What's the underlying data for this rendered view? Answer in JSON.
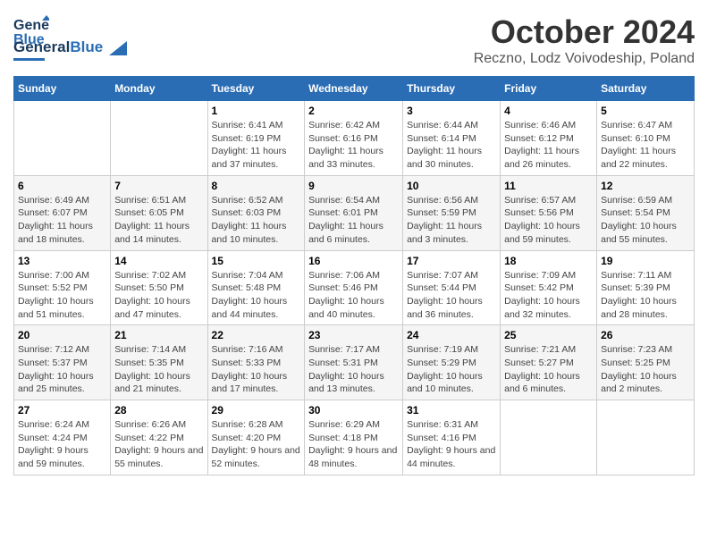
{
  "logo": {
    "general": "General",
    "blue": "Blue",
    "tagline": ""
  },
  "header": {
    "month": "October 2024",
    "location": "Reczno, Lodz Voivodeship, Poland"
  },
  "weekdays": [
    "Sunday",
    "Monday",
    "Tuesday",
    "Wednesday",
    "Thursday",
    "Friday",
    "Saturday"
  ],
  "weeks": [
    [
      {
        "day": "",
        "info": ""
      },
      {
        "day": "",
        "info": ""
      },
      {
        "day": "1",
        "info": "Sunrise: 6:41 AM\nSunset: 6:19 PM\nDaylight: 11 hours and 37 minutes."
      },
      {
        "day": "2",
        "info": "Sunrise: 6:42 AM\nSunset: 6:16 PM\nDaylight: 11 hours and 33 minutes."
      },
      {
        "day": "3",
        "info": "Sunrise: 6:44 AM\nSunset: 6:14 PM\nDaylight: 11 hours and 30 minutes."
      },
      {
        "day": "4",
        "info": "Sunrise: 6:46 AM\nSunset: 6:12 PM\nDaylight: 11 hours and 26 minutes."
      },
      {
        "day": "5",
        "info": "Sunrise: 6:47 AM\nSunset: 6:10 PM\nDaylight: 11 hours and 22 minutes."
      }
    ],
    [
      {
        "day": "6",
        "info": "Sunrise: 6:49 AM\nSunset: 6:07 PM\nDaylight: 11 hours and 18 minutes."
      },
      {
        "day": "7",
        "info": "Sunrise: 6:51 AM\nSunset: 6:05 PM\nDaylight: 11 hours and 14 minutes."
      },
      {
        "day": "8",
        "info": "Sunrise: 6:52 AM\nSunset: 6:03 PM\nDaylight: 11 hours and 10 minutes."
      },
      {
        "day": "9",
        "info": "Sunrise: 6:54 AM\nSunset: 6:01 PM\nDaylight: 11 hours and 6 minutes."
      },
      {
        "day": "10",
        "info": "Sunrise: 6:56 AM\nSunset: 5:59 PM\nDaylight: 11 hours and 3 minutes."
      },
      {
        "day": "11",
        "info": "Sunrise: 6:57 AM\nSunset: 5:56 PM\nDaylight: 10 hours and 59 minutes."
      },
      {
        "day": "12",
        "info": "Sunrise: 6:59 AM\nSunset: 5:54 PM\nDaylight: 10 hours and 55 minutes."
      }
    ],
    [
      {
        "day": "13",
        "info": "Sunrise: 7:00 AM\nSunset: 5:52 PM\nDaylight: 10 hours and 51 minutes."
      },
      {
        "day": "14",
        "info": "Sunrise: 7:02 AM\nSunset: 5:50 PM\nDaylight: 10 hours and 47 minutes."
      },
      {
        "day": "15",
        "info": "Sunrise: 7:04 AM\nSunset: 5:48 PM\nDaylight: 10 hours and 44 minutes."
      },
      {
        "day": "16",
        "info": "Sunrise: 7:06 AM\nSunset: 5:46 PM\nDaylight: 10 hours and 40 minutes."
      },
      {
        "day": "17",
        "info": "Sunrise: 7:07 AM\nSunset: 5:44 PM\nDaylight: 10 hours and 36 minutes."
      },
      {
        "day": "18",
        "info": "Sunrise: 7:09 AM\nSunset: 5:42 PM\nDaylight: 10 hours and 32 minutes."
      },
      {
        "day": "19",
        "info": "Sunrise: 7:11 AM\nSunset: 5:39 PM\nDaylight: 10 hours and 28 minutes."
      }
    ],
    [
      {
        "day": "20",
        "info": "Sunrise: 7:12 AM\nSunset: 5:37 PM\nDaylight: 10 hours and 25 minutes."
      },
      {
        "day": "21",
        "info": "Sunrise: 7:14 AM\nSunset: 5:35 PM\nDaylight: 10 hours and 21 minutes."
      },
      {
        "day": "22",
        "info": "Sunrise: 7:16 AM\nSunset: 5:33 PM\nDaylight: 10 hours and 17 minutes."
      },
      {
        "day": "23",
        "info": "Sunrise: 7:17 AM\nSunset: 5:31 PM\nDaylight: 10 hours and 13 minutes."
      },
      {
        "day": "24",
        "info": "Sunrise: 7:19 AM\nSunset: 5:29 PM\nDaylight: 10 hours and 10 minutes."
      },
      {
        "day": "25",
        "info": "Sunrise: 7:21 AM\nSunset: 5:27 PM\nDaylight: 10 hours and 6 minutes."
      },
      {
        "day": "26",
        "info": "Sunrise: 7:23 AM\nSunset: 5:25 PM\nDaylight: 10 hours and 2 minutes."
      }
    ],
    [
      {
        "day": "27",
        "info": "Sunrise: 6:24 AM\nSunset: 4:24 PM\nDaylight: 9 hours and 59 minutes."
      },
      {
        "day": "28",
        "info": "Sunrise: 6:26 AM\nSunset: 4:22 PM\nDaylight: 9 hours and 55 minutes."
      },
      {
        "day": "29",
        "info": "Sunrise: 6:28 AM\nSunset: 4:20 PM\nDaylight: 9 hours and 52 minutes."
      },
      {
        "day": "30",
        "info": "Sunrise: 6:29 AM\nSunset: 4:18 PM\nDaylight: 9 hours and 48 minutes."
      },
      {
        "day": "31",
        "info": "Sunrise: 6:31 AM\nSunset: 4:16 PM\nDaylight: 9 hours and 44 minutes."
      },
      {
        "day": "",
        "info": ""
      },
      {
        "day": "",
        "info": ""
      }
    ]
  ]
}
